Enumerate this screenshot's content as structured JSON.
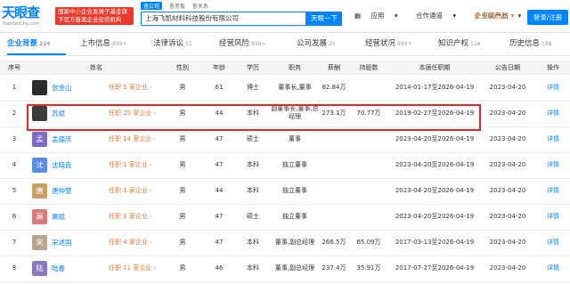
{
  "logo": {
    "main": "天眼查",
    "sub": "TianYanCha.com"
  },
  "banner": {
    "text": "国家中小企业发展子基金旗下官方备案企业征信机构"
  },
  "search": {
    "tabs": [
      "查公司",
      "查老板",
      "查关系"
    ],
    "query": "上海飞凯材料科技股份有限公司",
    "button": "天眼一下"
  },
  "nav": {
    "items": [
      "应用",
      "合作通道",
      "企业级产品"
    ],
    "vip": "开通会员",
    "login": "登录/注册"
  },
  "tabs": [
    {
      "label": "企业背景",
      "count": "224"
    },
    {
      "label": "上市信息",
      "count": "999+"
    },
    {
      "label": "法律诉讼",
      "count": "51"
    },
    {
      "label": "经营风险",
      "count": "999+"
    },
    {
      "label": "公司发展",
      "count": "25"
    },
    {
      "label": "经营状况",
      "count": "999+"
    },
    {
      "label": "知识产权",
      "count": "116"
    },
    {
      "label": "历史信息",
      "count": "188"
    }
  ],
  "table": {
    "headers": [
      "序号",
      "姓名",
      "性别",
      "年龄",
      "学历",
      "职务",
      "薪酬",
      "持股数",
      "本届任职期",
      "公告日期",
      "操作"
    ],
    "rows": [
      {
        "no": "1",
        "avatar": "",
        "avatar_color": "#2b2b2b",
        "name": "张金山",
        "tenure": "任职 1 家企业",
        "gender": "男",
        "age": "61",
        "edu": "博士",
        "position": "董事长,董事",
        "salary": "82.84万",
        "shares": "",
        "term": "2014-01-17至2026-04-19",
        "date": "2023-04-20",
        "op": "详情"
      },
      {
        "no": "2",
        "avatar": "",
        "avatar_color": "#3c3c3c",
        "name": "苏斌",
        "tenure": "任职 25 家企业",
        "gender": "男",
        "age": "44",
        "edu": "本科",
        "position": "副董事长,董事,总经理",
        "salary": "273.1万",
        "shares": "70.77万",
        "term": "2019-02-27至2026-04-19",
        "date": "2023-04-20",
        "op": "详情"
      },
      {
        "no": "3",
        "avatar": "孟",
        "avatar_color": "#7e6bc4",
        "name": "孟德庆",
        "tenure": "任职 14 家企业",
        "gender": "男",
        "age": "47",
        "edu": "硕士",
        "position": "董事",
        "salary": "",
        "shares": "",
        "term": "2023-04-20至2026-04-19",
        "date": "2023-04-20",
        "op": "详情"
      },
      {
        "no": "4",
        "avatar": "沈",
        "avatar_color": "#5b8de8",
        "name": "沈晓良",
        "tenure": "任职 1 家企业",
        "gender": "男",
        "age": "47",
        "edu": "本科",
        "position": "独立董事",
        "salary": "",
        "shares": "",
        "term": "2023-04-20至2026-04-19",
        "date": "2023-04-20",
        "op": "详情"
      },
      {
        "no": "5",
        "avatar": "唐",
        "avatar_color": "#c8a06a",
        "name": "唐仲慧",
        "tenure": "任职 1 家企业",
        "gender": "男",
        "age": "44",
        "edu": "本科",
        "position": "独立董事",
        "salary": "",
        "shares": "",
        "term": "2023-04-20至2026-04-19",
        "date": "2023-04-20",
        "op": "详情"
      },
      {
        "no": "6",
        "avatar": "屠",
        "avatar_color": "#d77a7a",
        "name": "屠斌",
        "tenure": "任职 1 家企业",
        "gender": "男",
        "age": "47",
        "edu": "硕士",
        "position": "独立董事",
        "salary": "",
        "shares": "",
        "term": "2023-04-20至2026-04-19",
        "date": "2023-04-20",
        "op": "详情"
      },
      {
        "no": "7",
        "avatar": "宋",
        "avatar_color": "#b8a58d",
        "name": "宋述国",
        "tenure": "任职 4 家企业",
        "gender": "男",
        "age": "47",
        "edu": "本科",
        "position": "董事,副总经理",
        "salary": "266.5万",
        "shares": "65.09万",
        "term": "2017-03-13至2026-04-19",
        "date": "2023-04-20",
        "op": "详情"
      },
      {
        "no": "8",
        "avatar": "陆",
        "avatar_color": "#8a7ac0",
        "name": "陆春",
        "tenure": "任职 11 家企业",
        "gender": "男",
        "age": "46",
        "edu": "本科",
        "position": "董事,副总经理",
        "salary": "237.4万",
        "shares": "35.91万",
        "term": "2017-07-27至2026-04-19",
        "date": "2023-04-20",
        "op": "详情"
      }
    ]
  },
  "colors": {
    "brand": "#0084ff",
    "highlight": "#e5252a",
    "orange": "#e8792d"
  }
}
